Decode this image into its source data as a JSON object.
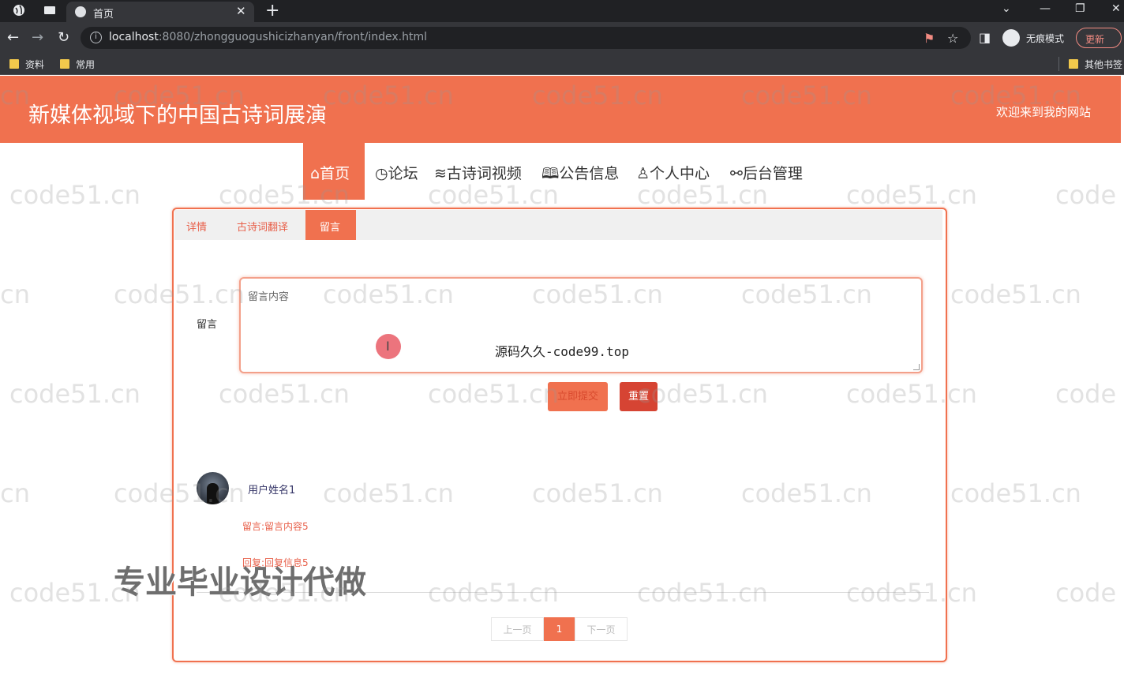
{
  "browser": {
    "tab_title": "首页",
    "url_host": "localhost",
    "url_rest": ":8080/zhongguogushicizhanyan/front/index.html",
    "incognito_label": "无痕模式",
    "update_label": "更新",
    "bookmarks": [
      "资料",
      "常用"
    ],
    "other_bookmarks": "其他书签"
  },
  "site": {
    "title": "新媒体视域下的中国古诗词展演",
    "welcome": "欢迎来到我的网站"
  },
  "nav": [
    {
      "label": "首页",
      "icon": "⌂"
    },
    {
      "label": "论坛",
      "icon": "◷"
    },
    {
      "label": "古诗词视频",
      "icon": "≋"
    },
    {
      "label": "公告信息",
      "icon": "🕮"
    },
    {
      "label": "个人中心",
      "icon": "♙"
    },
    {
      "label": "后台管理",
      "icon": "⚯"
    }
  ],
  "tabs": [
    "详情",
    "古诗词翻译",
    "留言"
  ],
  "form": {
    "label": "留言",
    "placeholder": "留言内容",
    "submit": "立即提交",
    "reset": "重置"
  },
  "overlay": {
    "source_mark": "源码久久-code99.top",
    "promo": "专业毕业设计代做",
    "watermark": "code51.cn"
  },
  "comment": {
    "username": "用户姓名1",
    "message": "留言:留言内容5",
    "reply": "回复:回复信息5"
  },
  "pager": {
    "prev": "上一页",
    "current": "1",
    "next": "下一页"
  },
  "colors": {
    "accent": "#f0714f",
    "reset_button": "#d64433",
    "chrome_dark": "#202124"
  }
}
